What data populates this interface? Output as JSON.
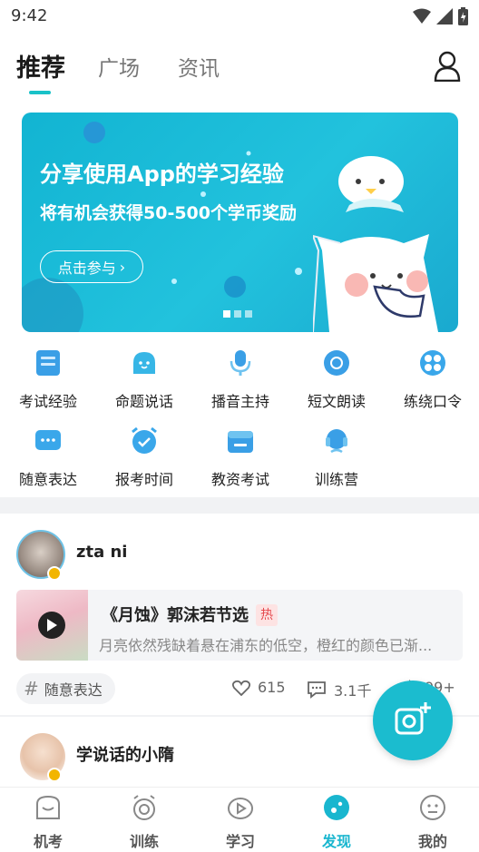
{
  "status_bar": {
    "time": "9:42"
  },
  "top_tabs": [
    {
      "label": "推荐",
      "active": true
    },
    {
      "label": "广场",
      "active": false
    },
    {
      "label": "资讯",
      "active": false
    }
  ],
  "banner": {
    "title": "分享使用App的学习经验",
    "subtitle": "将有机会获得50-500个学币奖励",
    "button_label": "点击参与",
    "button_arrow": "›",
    "slide_count": 3,
    "active_slide": 0
  },
  "grid": [
    {
      "label": "考试经验",
      "icon": "exam-experience-icon"
    },
    {
      "label": "命题说话",
      "icon": "topic-speech-icon"
    },
    {
      "label": "播音主持",
      "icon": "microphone-icon"
    },
    {
      "label": "短文朗读",
      "icon": "reading-icon"
    },
    {
      "label": "练绕口令",
      "icon": "tongue-twister-icon"
    },
    {
      "label": "随意表达",
      "icon": "free-expression-icon"
    },
    {
      "label": "报考时间",
      "icon": "alarm-clock-icon"
    },
    {
      "label": "教资考试",
      "icon": "teacher-exam-icon"
    },
    {
      "label": "训练营",
      "icon": "training-camp-icon"
    }
  ],
  "post": {
    "username": "zta ni",
    "article_title": "《月蚀》郭沫若节选",
    "hot_badge": "热",
    "article_text": "月亮依然残缺着悬在浦东的低空，橙红的颜色已渐...",
    "tag": "随意表达",
    "likes": "615",
    "comments": "3.1千",
    "shares": "99+"
  },
  "post2": {
    "username": "学说话的小隋"
  },
  "bottom_nav": [
    {
      "label": "机考",
      "active": false
    },
    {
      "label": "训练",
      "active": false
    },
    {
      "label": "学习",
      "active": false
    },
    {
      "label": "发现",
      "active": true
    },
    {
      "label": "我的",
      "active": false
    }
  ],
  "colors": {
    "accent": "#19c2c8",
    "banner": "#1ab8d4",
    "hot": "#e5484d"
  }
}
